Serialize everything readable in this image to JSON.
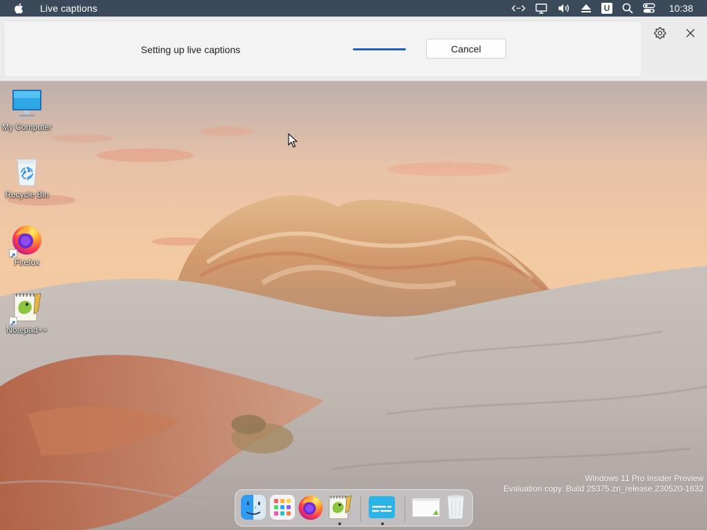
{
  "menubar": {
    "app_title": "Live captions",
    "clock": "10:38",
    "tray_icons": [
      "code-icon",
      "display-icon",
      "volume-icon",
      "eject-icon",
      "u-app-icon",
      "search-icon",
      "control-center-icon"
    ],
    "u_label": "U",
    "background": "#3b4a5a"
  },
  "live_captions": {
    "status_text": "Setting up live captions",
    "progress": 1.0,
    "cancel_label": "Cancel",
    "accent": "#1a5fb4"
  },
  "desktop_icons": [
    {
      "label": "My Computer",
      "icon": "monitor-icon"
    },
    {
      "label": "Recycle Bin",
      "icon": "recycle-bin-icon"
    },
    {
      "label": "Firefox",
      "icon": "firefox-icon"
    },
    {
      "label": "Notepad++",
      "icon": "notepadpp-icon"
    }
  ],
  "watermark": {
    "line1": "Windows 11 Pro Insider Preview",
    "line2": "Evaluation copy. Build 25375.zn_release.230520-1632"
  },
  "dock": {
    "items": [
      {
        "name": "finder",
        "icon": "finder-icon",
        "running": false
      },
      {
        "name": "launchpad",
        "icon": "launchpad-icon",
        "running": false
      },
      {
        "name": "firefox",
        "icon": "firefox-icon",
        "running": false
      },
      {
        "name": "notepad++",
        "icon": "notepadpp-icon",
        "running": true
      },
      {
        "name": "live-captions",
        "icon": "live-captions-icon",
        "running": true
      },
      {
        "name": "window-preview",
        "icon": "window-preview-icon",
        "running": false
      },
      {
        "name": "trash",
        "icon": "trash-icon",
        "running": false
      }
    ]
  }
}
